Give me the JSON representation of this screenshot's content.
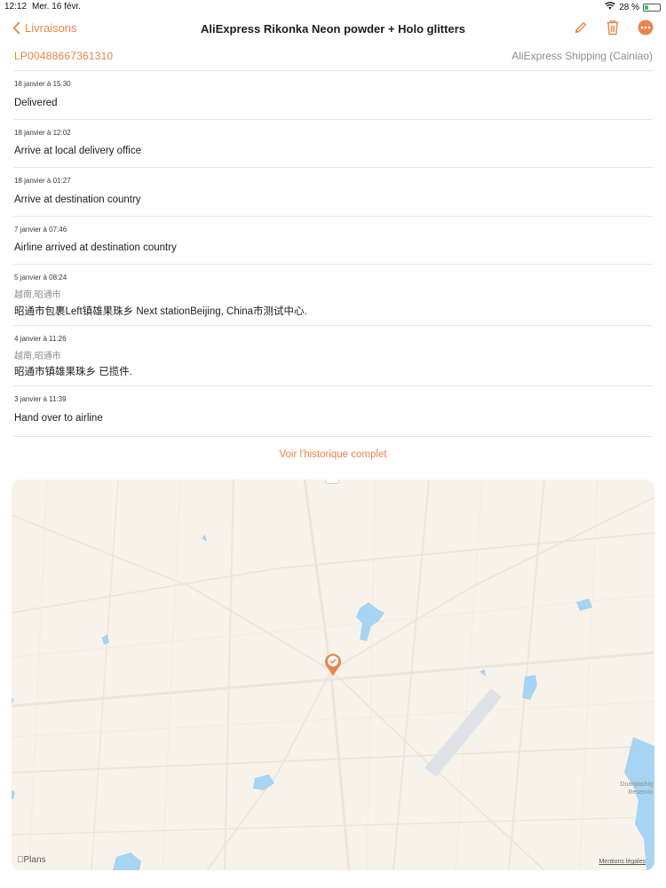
{
  "status_bar": {
    "time": "12:12",
    "date": "Mer. 16 févr.",
    "battery": "28 %",
    "battery_level": 0.28
  },
  "nav": {
    "back_label": "Livraisons",
    "title": "AliExpress Rikonka Neon powder + Holo glitters",
    "icons": [
      "pencil-icon",
      "trash-icon",
      "more-icon"
    ]
  },
  "shipment": {
    "tracking_number": "LP00488667361310",
    "carrier": "AliExpress Shipping (Cainiao)"
  },
  "events": [
    {
      "date": "18 janvier à 15:30",
      "location": "",
      "description": "Delivered"
    },
    {
      "date": "18 janvier à 12:02",
      "location": "",
      "description": "Arrive at local delivery office"
    },
    {
      "date": "18 janvier à 01:27",
      "location": "",
      "description": "Arrive at destination country"
    },
    {
      "date": "7 janvier à 07:46",
      "location": "",
      "description": "Airline arrived at destination country"
    },
    {
      "date": "5 janvier à 08:24",
      "location": "越南,昭通市",
      "description": "昭通市包裹Left镇雄果珠乡 Next stationBeijing, China市测试中心."
    },
    {
      "date": "4 janvier à 11:26",
      "location": "越南,昭通市",
      "description": "昭通市镇雄果珠乡 已揽件."
    },
    {
      "date": "3 janvier à 11:39",
      "location": "",
      "description": "Hand over to airline"
    }
  ],
  "history_link": "Voir l'historique complet",
  "map": {
    "logo": "Plans",
    "legal": "Mentions légales",
    "labels": [
      "Duanjiashiq",
      "Reservoi"
    ]
  },
  "colors": {
    "accent": "#e8864a",
    "map_bg": "#f8f3ea",
    "water": "#a6d4f2"
  }
}
